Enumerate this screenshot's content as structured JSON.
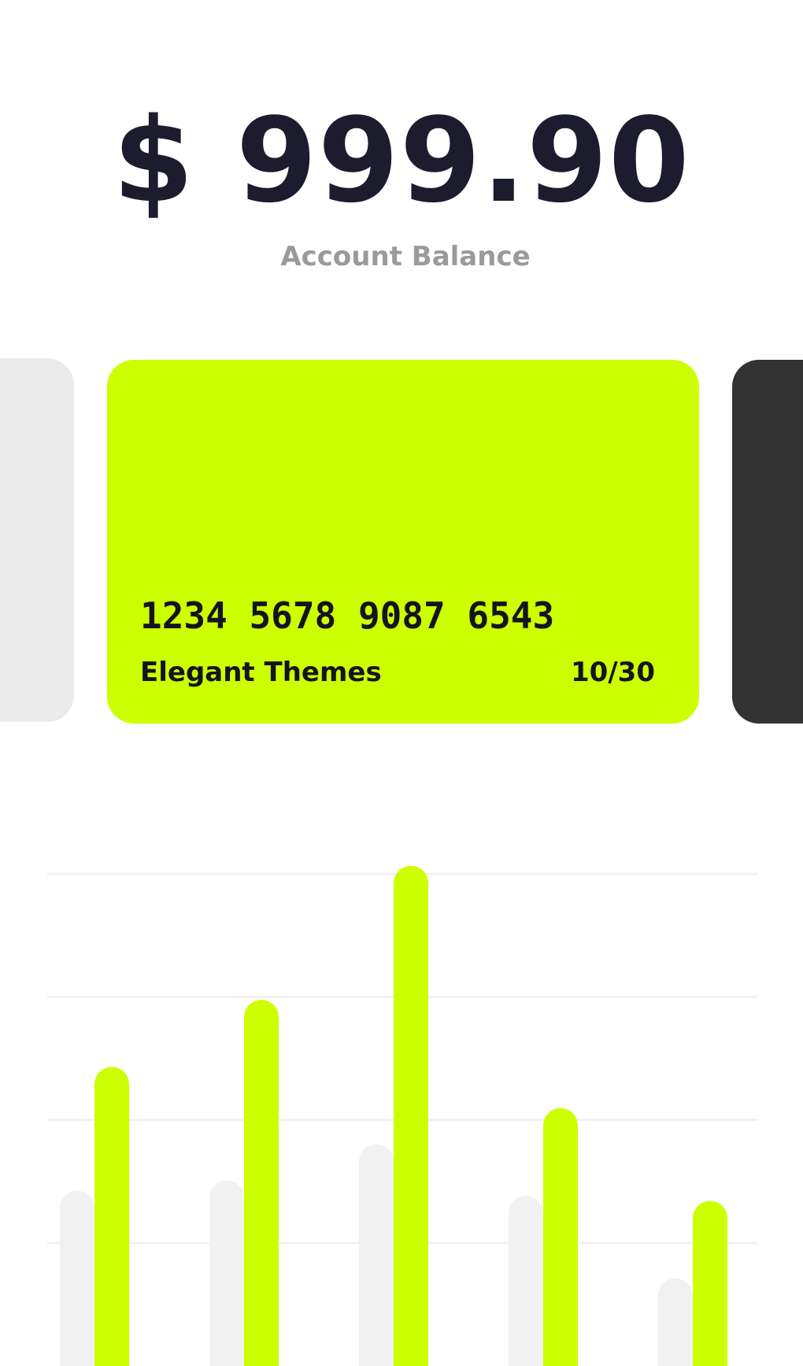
{
  "balance": {
    "amount": "$ 999.90",
    "label": "Account Balance"
  },
  "card": {
    "number": "1234 5678 9087 6543",
    "holder": "Elegant Themes",
    "expiry": "10/30",
    "color": "#ccff00"
  },
  "cards_carousel": {
    "left_card_color": "#ebebeb",
    "right_card_color": "#333333"
  },
  "colors": {
    "text_dark": "#1c1c2e",
    "text_muted": "#9a9a9a",
    "accent": "#ccff00",
    "secondary_bar": "#f1f1f1",
    "gridline": "#f0f0f5"
  },
  "chart_data": {
    "type": "bar",
    "title": "",
    "xlabel": "",
    "ylabel": "",
    "categories": [
      "",
      "",
      "",
      "",
      ""
    ],
    "ylim": [
      0,
      100
    ],
    "grid": true,
    "series": [
      {
        "color": "#f1f1f1",
        "values": [
          34,
          36,
          43,
          33,
          17
        ]
      },
      {
        "color": "#ccff00",
        "values": [
          58,
          71,
          97,
          50,
          32
        ]
      }
    ]
  }
}
